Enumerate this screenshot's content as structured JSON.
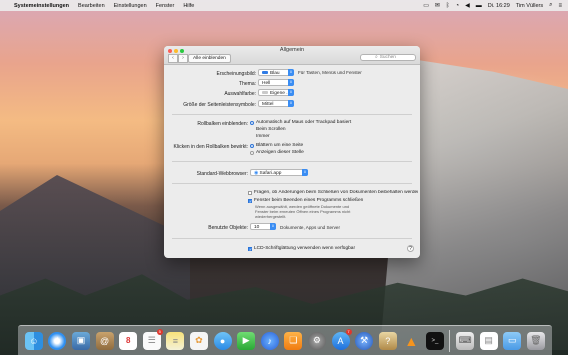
{
  "menubar": {
    "app_name": "Systemeinstellungen",
    "items": [
      "Bearbeiten",
      "Einstellungen",
      "Fenster",
      "Hilfe"
    ],
    "clock": "Di. 16:29",
    "user": "Tim Vüllers"
  },
  "window": {
    "title": "Allgemein",
    "show_all": "Alle einblenden",
    "search_placeholder": "Suchen",
    "appearance_label": "Erscheinungsbild:",
    "appearance_value": "Blau",
    "appearance_note": "Für Tasten, Menüs und Fenster",
    "theme_label": "Thema:",
    "theme_value": "Hell",
    "highlight_label": "Auswahlfarbe:",
    "highlight_value": "Eigene ...",
    "sidebar_label": "Größe der Seitenleistensymbole:",
    "sidebar_value": "Mittel",
    "scrollbars_label": "Rollbalken einblenden:",
    "scrollbars_options": [
      "Automatisch auf Maus oder Trackpad basiert",
      "Beim Scrollen",
      "Immer"
    ],
    "scrollclick_label": "Klicken in den Rollbalken bewirkt:",
    "scrollclick_options": [
      "Blättern um eine Seite",
      "Anzeigen dieser Stelle"
    ],
    "browser_label": "Standard-Webbrowser:",
    "browser_value": "Safari.app",
    "ask_changes": "Fragen, ob Änderungen beim Schließen von Dokumenten beibehalten werden sollen",
    "close_windows": "Fenster beim Beenden eines Programms schließen",
    "close_windows_note": "Wenn ausgewählt, werden geöffnete Dokumente und Fenster beim erneuten Öffnen eines Programms nicht wiederhergestellt.",
    "recent_label": "Benutzte Objekte:",
    "recent_value": "10",
    "recent_note": "Dokumente, Apps und Server",
    "lcd": "LCD-Schriftglättung verwenden wenn verfügbar",
    "help": "?"
  },
  "dock": {
    "icons": [
      "finder-icon",
      "safari-icon",
      "preview-icon",
      "contacts-icon",
      "calendar-icon",
      "reminders-icon",
      "notes-icon",
      "photos-icon",
      "messages-icon",
      "facetime-icon",
      "itunes-icon",
      "ibooks-icon",
      "system-preferences-icon",
      "app-store-icon",
      "xcode-icon",
      "unknown-app-icon",
      "vlc-icon",
      "terminal-icon",
      "keyboard-icon",
      "text-file-icon",
      "folder-icon",
      "trash-icon"
    ],
    "calendar_day": "8",
    "calendar_badge": "5",
    "app_store_badge": "7"
  }
}
